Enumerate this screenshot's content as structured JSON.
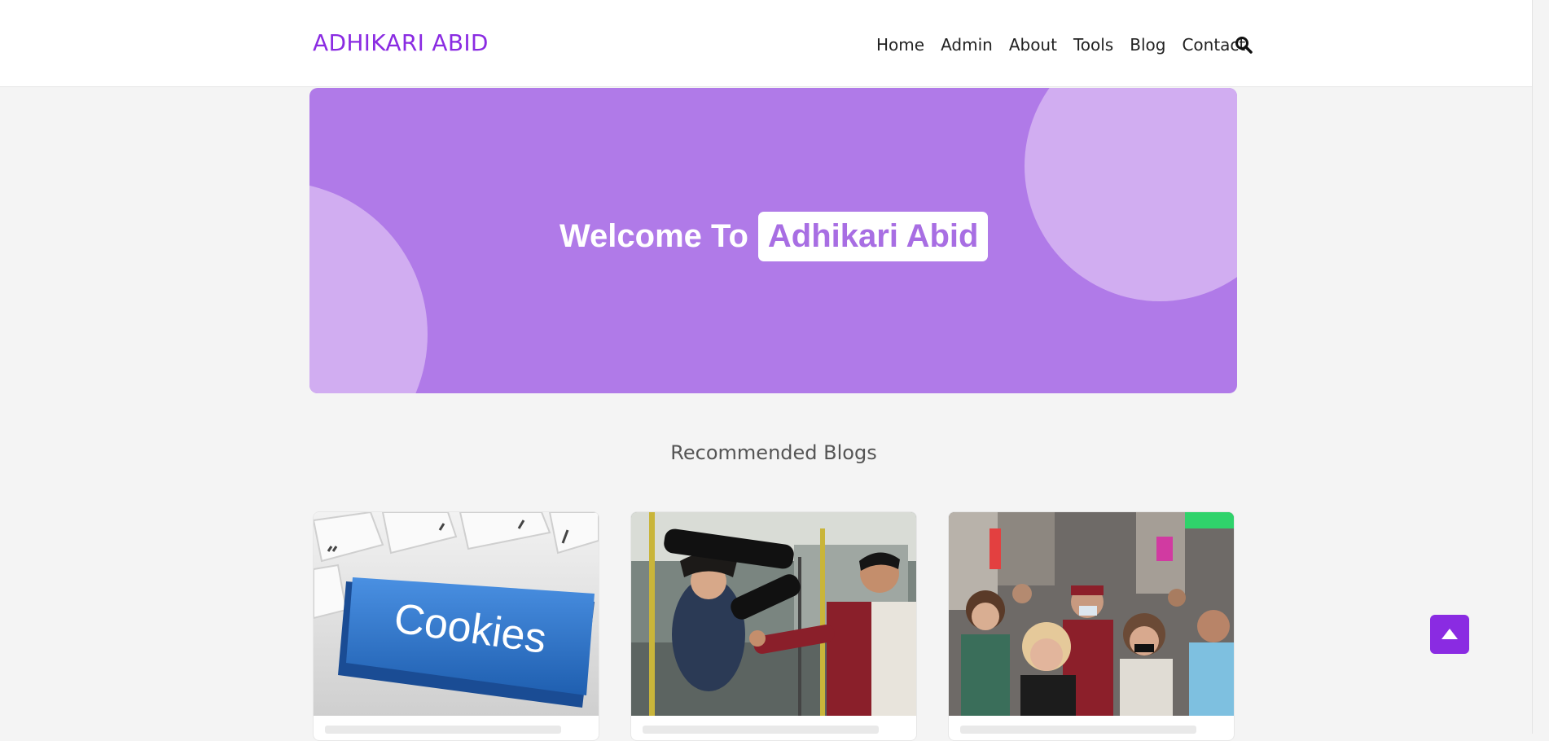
{
  "navbar": {
    "brand": "ADHIKARI ABID",
    "links": [
      "Home",
      "Admin",
      "About",
      "Tools",
      "Blog",
      "Contact"
    ],
    "search_icon": "search-icon"
  },
  "hero": {
    "welcome": "Welcome To",
    "name": "Adhikari Abid"
  },
  "section": {
    "title": "Recommended Blogs"
  },
  "cards": [
    {
      "image": "Cookies keyboard key"
    },
    {
      "image": "Action movie scene on a train"
    },
    {
      "image": "Crowd of people walking in the city"
    }
  ],
  "colors": {
    "brand": "#8a2be2",
    "hero_bg": "#b07ae8",
    "hero_circle": "#d1adf1",
    "page_bg": "#f4f4f4"
  },
  "scroll_top_icon": "arrow-up-icon"
}
